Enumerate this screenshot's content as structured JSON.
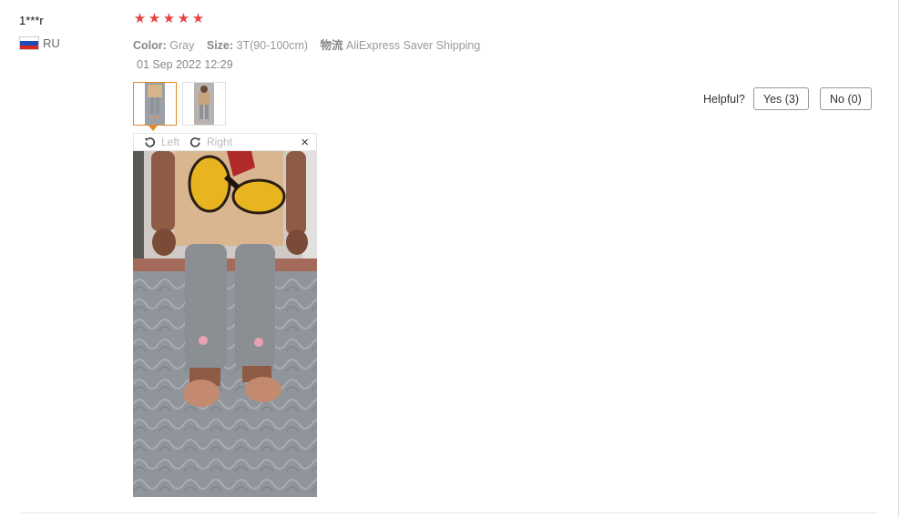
{
  "review": {
    "username": "1***r",
    "country_code": "RU",
    "rating": 5,
    "star_color": "#e8433f",
    "sku": {
      "color_key": "Color:",
      "color_value": "Gray",
      "size_key": "Size:",
      "size_value": "3T(90-100cm)",
      "logistics_key": "物流",
      "logistics_value": "AliExpress Saver Shipping"
    },
    "date": "01 Sep 2022 12:29"
  },
  "viewer": {
    "rotate_left_label": "Left",
    "rotate_right_label": "Right",
    "close_label": "×"
  },
  "helpful": {
    "label": "Helpful?",
    "yes_label": "Yes (3)",
    "no_label": "No (0)"
  },
  "colors": {
    "active_thumb_border": "#e08a2a"
  }
}
